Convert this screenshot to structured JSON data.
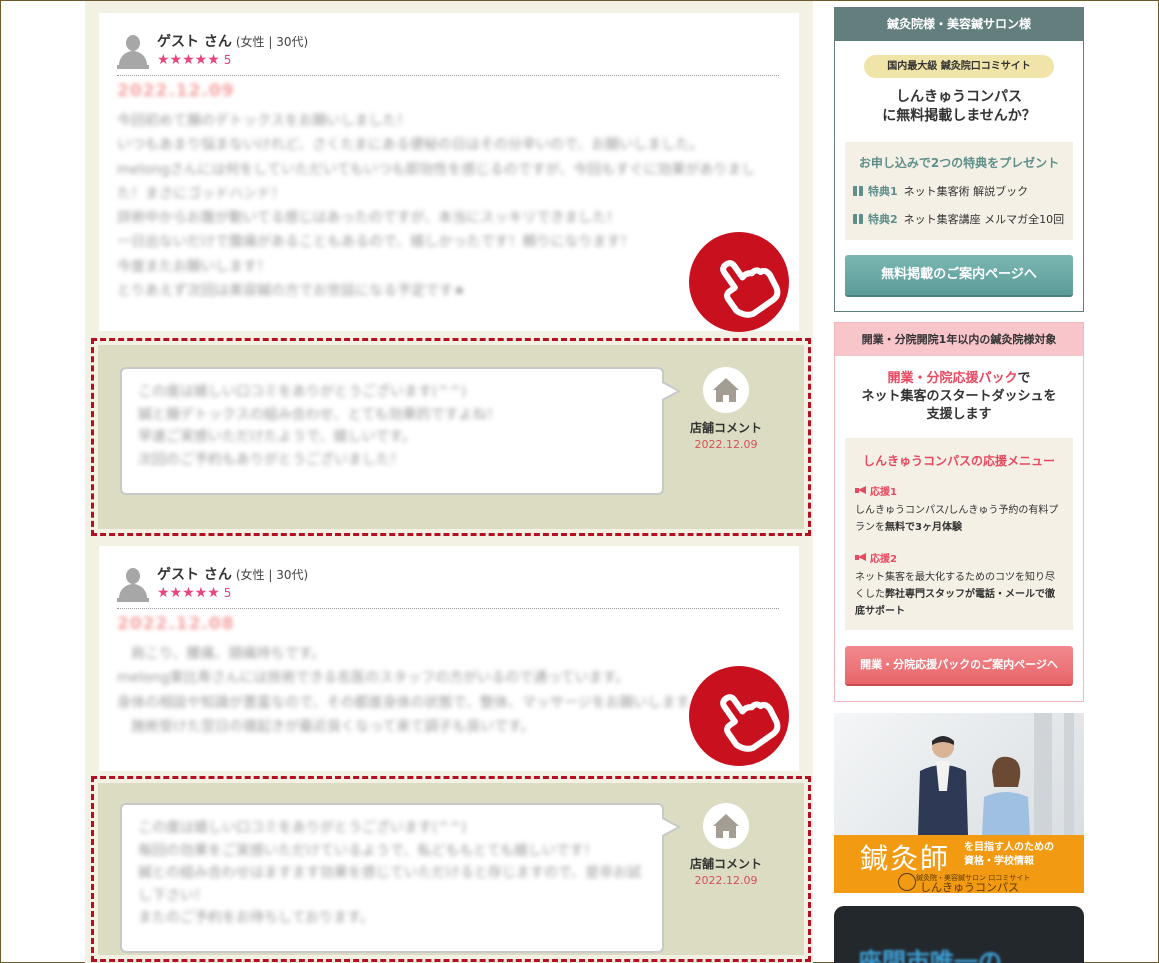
{
  "reviews": [
    {
      "user": "ゲスト さん",
      "meta": "(女性 | 30代)",
      "stars": "★★★★★",
      "rating": "5",
      "date": "2022.12.09",
      "body": "今回初めて腸のデトックスをお願いしました！\nいつもあまり悩まないけれど、さくたまにある便秘の日はその分辛いので、お願いしました。\nmelongさんには何をしていただいてもいつも即効性を感じるのですが、今回もすぐに効果がありました！まさにゴッドハンド！\n詳術中からお腹が動いてる感じはあったのですが、本当にスッキリできました！\n一日出ないだけで腹痛があることもあるので、嬉しかったです！頼りになります！\n今度またお願いします！\nとりあえず次回は美容鍼の方でお世話になる予定です★",
      "shop_comment": {
        "text": "この度は嬉しい口コミをありがとうございます(^^)\n鍼と腸デトックスの組み合わせ、とても効果的ですよね！\n早速ご実感いただけたようで、嬉しいです。\n次回のご予約もありがとうございました！",
        "label": "店舗コメント",
        "date": "2022.12.09"
      }
    },
    {
      "user": "ゲスト さん",
      "meta": "(女性 | 30代)",
      "stars": "★★★★★",
      "rating": "5",
      "date": "2022.12.08",
      "body": "　肩こり、腰痛、頭痛持ちです。\nmelong東比寿さんには技術できる名医のスタッフの方がいるので通っています。\n身体の相談や知識が豊富なので、その都度身体の状態で、整体、マッサージをお願いします。\n　施術受けた翌日の寝起きが最近良くなって来て調子も良いです。",
      "shop_comment": {
        "text": "この度は嬉しい口コミをありがとうございます(^^)\n毎回の効果をご実感いただけているようで、私どももとても嬉しいです！\n鍼との組み合わせはますます効果を感じていただけると存じますので、是非お試し下さい！\nまたのご予約をお待ちしております。",
        "label": "店舗コメント",
        "date": "2022.12.09"
      }
    }
  ],
  "sidebar": {
    "box1": {
      "header": "鍼灸院様・美容鍼サロン様",
      "pill": "国内最大級 鍼灸院口コミサイト",
      "headline_1": "しんきゅうコンパス",
      "headline_2": "に無料掲載しませんか？",
      "gift_title": "お申し込みで2つの特典をプレゼント",
      "gift1_tag": "特典1",
      "gift1_text": "ネット集客術 解説ブック",
      "gift2_tag": "特典2",
      "gift2_text": "ネット集客講座 メルマガ全10回",
      "button": "無料掲載のご案内ページへ"
    },
    "box2": {
      "header": "開業・分院開院1年以内の鍼灸院様対象",
      "headline_pink": "開業・分院応援パック",
      "headline_1": "で",
      "headline_2": "ネット集客のスタートダッシュを",
      "headline_3": "支援します",
      "menu_title": "しんきゅうコンパスの応援メニュー",
      "item1_tag": "応援1",
      "item1_a": "しんきゅうコンパス/しんきゅう予約の有料プランを",
      "item1_b": "無料で3ヶ月体験",
      "item2_tag": "応援2",
      "item2_a": "ネット集客を最大化するためのコツを知り尽くした",
      "item2_b": "弊社専門スタッフが電話・メールで徹底サポート",
      "button": "開業・分院応援パックのご案内ページへ"
    },
    "banner": {
      "big": "鍼灸師",
      "sub_1": "を目指す人のための",
      "sub_2": "資格・学校情報",
      "small": "鍼灸院・美容鍼サロン 口コミサイト",
      "logo": "しんきゅうコンパス"
    },
    "dark_text": "座間市唯一の"
  },
  "colors": {
    "accent_red": "#c8101e",
    "teal": "#627f7d",
    "pink": "#e84860",
    "orange": "#f19a12"
  }
}
